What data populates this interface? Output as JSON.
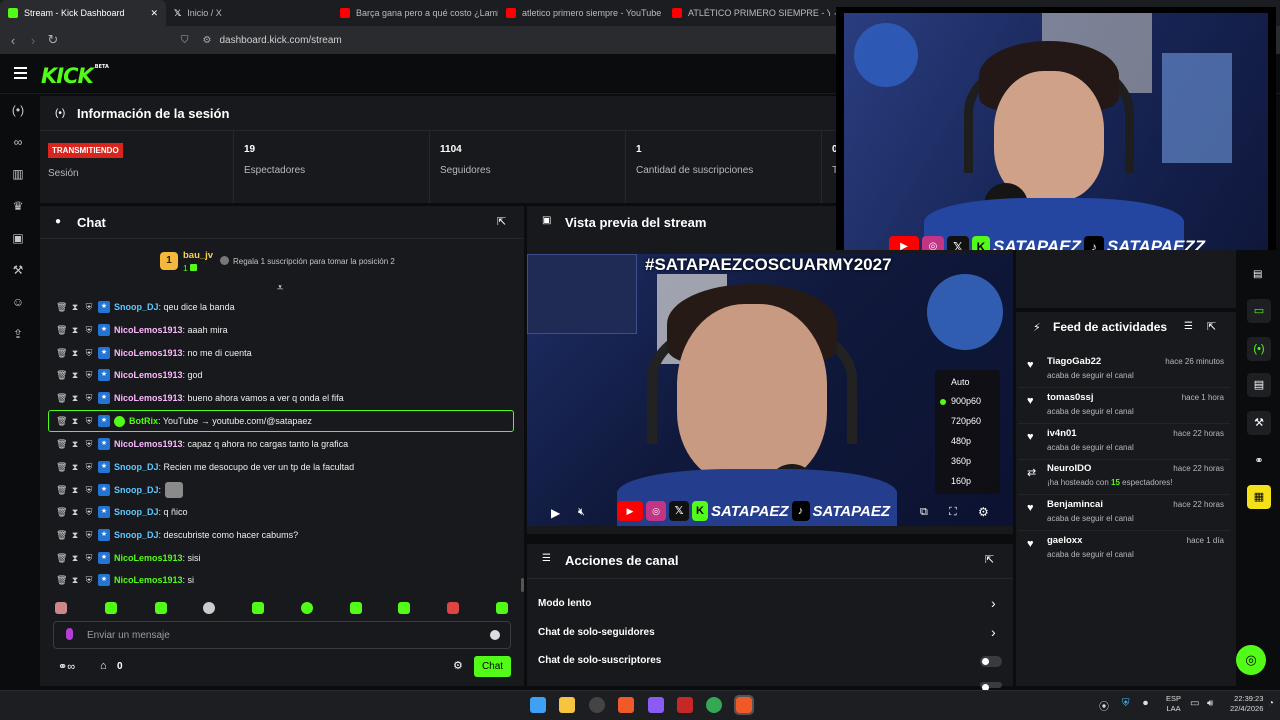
{
  "browser": {
    "tabs": [
      {
        "title": "Stream - Kick Dashboard",
        "color": "#53fc18",
        "active": true
      },
      {
        "title": "Inicio / X",
        "color": "#000000",
        "active": false
      },
      {
        "title": "Barça gana pero a qué costo ¿Lamine…",
        "color": "#ff0000",
        "active": false
      },
      {
        "title": "atletico primero siempre - YouTube",
        "color": "#ff0000",
        "active": false
      },
      {
        "title": "ATLÉTICO PRIMERO SIEMPRE - YouTu…",
        "color": "#ff0000",
        "active": false
      }
    ],
    "new_tab": "+",
    "url": "dashboard.kick.com/stream"
  },
  "kick": {
    "logo": "KICK",
    "logo_badge": "BETA"
  },
  "session": {
    "title": "Información de la sesión",
    "live_badge": "TRANSMITIENDO",
    "cells": [
      {
        "value": "",
        "label": "Sesión"
      },
      {
        "value": "19",
        "label": "Espectadores"
      },
      {
        "value": "1104",
        "label": "Seguidores"
      },
      {
        "value": "1",
        "label": "Cantidad de suscripciones"
      },
      {
        "value": "0",
        "label": "T"
      }
    ]
  },
  "chat": {
    "title": "Chat",
    "top_gifter": {
      "name": "bau_jv",
      "rank": "1",
      "count": "1"
    },
    "gift_prompt": "Regala 1 suscripción para tomar la posición 2",
    "messages": [
      {
        "user": "Snoop_DJ",
        "text": ": qeu dice la banda",
        "color": "#5fc8ff"
      },
      {
        "user": "NicoLemos1913",
        "text": ": aaah mira",
        "color": "#fcb8ff"
      },
      {
        "user": "NicoLemos1913",
        "text": ": no me di cuenta",
        "color": "#fcb8ff"
      },
      {
        "user": "NicoLemos1913",
        "text": ": god",
        "color": "#fcb8ff"
      },
      {
        "user": "NicoLemos1913",
        "text": ": bueno ahora vamos a ver q onda el fifa",
        "color": "#fcb8ff"
      },
      {
        "user": "BotRix",
        "text": ": YouTube → youtube.com/@satapaez",
        "color": "#53fc18"
      },
      {
        "user": "NicoLemos1913",
        "text": ": capaz q ahora no cargas tanto la grafica",
        "color": "#fcb8ff"
      },
      {
        "user": "Snoop_DJ",
        "text": ": Recien me desocupo de ver un tp de la facultad",
        "color": "#5fc8ff"
      },
      {
        "user": "Snoop_DJ",
        "text": ":",
        "color": "#5fc8ff"
      },
      {
        "user": "Snoop_DJ",
        "text": ": q ñico",
        "color": "#5fc8ff"
      },
      {
        "user": "Snoop_DJ",
        "text": ": descubriste como hacer cabums?",
        "color": "#5fc8ff"
      },
      {
        "user": "NicoLemos1913",
        "text": ": sisi",
        "color": "#53fc18"
      },
      {
        "user": "NicoLemos1913",
        "text": ": si",
        "color": "#53fc18"
      }
    ],
    "input_placeholder": "Enviar un mensaje",
    "points": "0",
    "send_label": "Chat"
  },
  "preview": {
    "title": "Vista previa del stream",
    "overlay_hashtag": "#SATAPAEZCOSCUARMY2027",
    "handle_1": "SATAPAEZ",
    "handle_2": "SATAPAEZ",
    "quality_options": [
      "Auto",
      "900p60",
      "720p60",
      "480p",
      "360p",
      "160p"
    ],
    "quality_selected": "900p60"
  },
  "actions": {
    "title": "Acciones de canal",
    "items": [
      {
        "label": "Modo lento",
        "control": "chevron"
      },
      {
        "label": "Chat de solo-seguidores",
        "control": "chevron"
      },
      {
        "label": "Chat de solo-suscriptores",
        "control": "toggle"
      }
    ]
  },
  "feed": {
    "title": "Feed de actividades",
    "items": [
      {
        "name": "TiagoGab22",
        "sub": "acaba de seguir el canal",
        "time": "hace 26 minutos",
        "icon": "heart"
      },
      {
        "name": "tomas0ssj",
        "sub": "acaba de seguir el canal",
        "time": "hace 1 hora",
        "icon": "heart"
      },
      {
        "name": "iv4n01",
        "sub": "acaba de seguir el canal",
        "time": "hace 22 horas",
        "icon": "heart"
      },
      {
        "name": "NeuroIDO",
        "sub_pre": "¡ha hosteado con ",
        "sub_num": "15",
        "sub_post": " espectadores!",
        "time": "hace 22 horas",
        "icon": "host"
      },
      {
        "name": "Benjamincai",
        "sub": "acaba de seguir el canal",
        "time": "hace 22 horas",
        "icon": "heart"
      },
      {
        "name": "gaeloxx",
        "sub": "acaba de seguir el canal",
        "time": "hace 1 día",
        "icon": "heart"
      }
    ]
  },
  "webcam": {
    "handle_1": "SATAPAEZ",
    "handle_2": "SATAPAEZZ"
  },
  "taskbar": {
    "lang": "ESP",
    "lang2": "LAA",
    "time": "22:39:23",
    "date": "22/4/2026"
  }
}
